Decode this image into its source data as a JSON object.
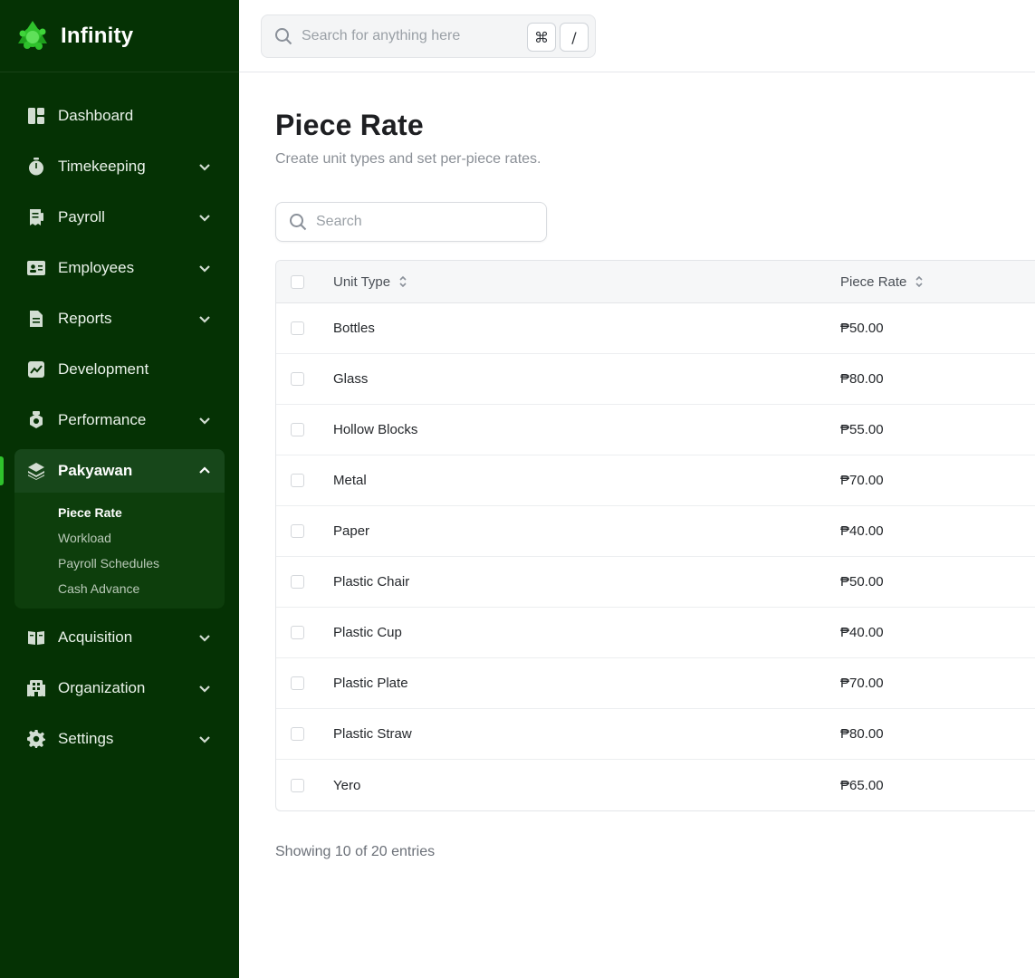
{
  "brand": {
    "name": "Infinity",
    "logo_icon": "recycle-logo-icon",
    "logo_color": "#2fc22c"
  },
  "colors": {
    "sidebar_bg": "#053204",
    "accent": "#2fc22c"
  },
  "search": {
    "placeholder": "Search for anything here",
    "shortcut_key_1": "⌘",
    "shortcut_key_2": "/"
  },
  "sidebar": {
    "items": [
      {
        "label": "Dashboard",
        "icon": "dashboard-icon",
        "expandable": false
      },
      {
        "label": "Timekeeping",
        "icon": "stopwatch-icon",
        "expandable": true
      },
      {
        "label": "Payroll",
        "icon": "receipt-icon",
        "expandable": true
      },
      {
        "label": "Employees",
        "icon": "id-card-icon",
        "expandable": true
      },
      {
        "label": "Reports",
        "icon": "report-file-icon",
        "expandable": true
      },
      {
        "label": "Development",
        "icon": "trend-chart-icon",
        "expandable": false
      },
      {
        "label": "Performance",
        "icon": "performance-badge-icon",
        "expandable": true
      },
      {
        "label": "Pakyawan",
        "icon": "layers-icon",
        "expandable": true,
        "expanded": true,
        "active": true,
        "children": [
          {
            "label": "Piece Rate",
            "current": true
          },
          {
            "label": "Workload"
          },
          {
            "label": "Payroll Schedules"
          },
          {
            "label": "Cash Advance"
          }
        ]
      },
      {
        "label": "Acquisition",
        "icon": "book-open-icon",
        "expandable": true
      },
      {
        "label": "Organization",
        "icon": "building-icon",
        "expandable": true
      },
      {
        "label": "Settings",
        "icon": "gear-icon",
        "expandable": true
      }
    ]
  },
  "page": {
    "title": "Piece Rate",
    "subtitle": "Create unit types and set per-piece rates."
  },
  "table": {
    "search_placeholder": "Search",
    "columns": [
      "Unit Type",
      "Piece Rate"
    ],
    "rows": [
      {
        "unit_type": "Bottles",
        "piece_rate": "₱50.00"
      },
      {
        "unit_type": "Glass",
        "piece_rate": "₱80.00"
      },
      {
        "unit_type": "Hollow Blocks",
        "piece_rate": "₱55.00"
      },
      {
        "unit_type": "Metal",
        "piece_rate": "₱70.00"
      },
      {
        "unit_type": "Paper",
        "piece_rate": "₱40.00"
      },
      {
        "unit_type": "Plastic Chair",
        "piece_rate": "₱50.00"
      },
      {
        "unit_type": "Plastic Cup",
        "piece_rate": "₱40.00"
      },
      {
        "unit_type": "Plastic Plate",
        "piece_rate": "₱70.00"
      },
      {
        "unit_type": "Plastic Straw",
        "piece_rate": "₱80.00"
      },
      {
        "unit_type": "Yero",
        "piece_rate": "₱65.00"
      }
    ],
    "footer": "Showing 10 of 20 entries"
  }
}
